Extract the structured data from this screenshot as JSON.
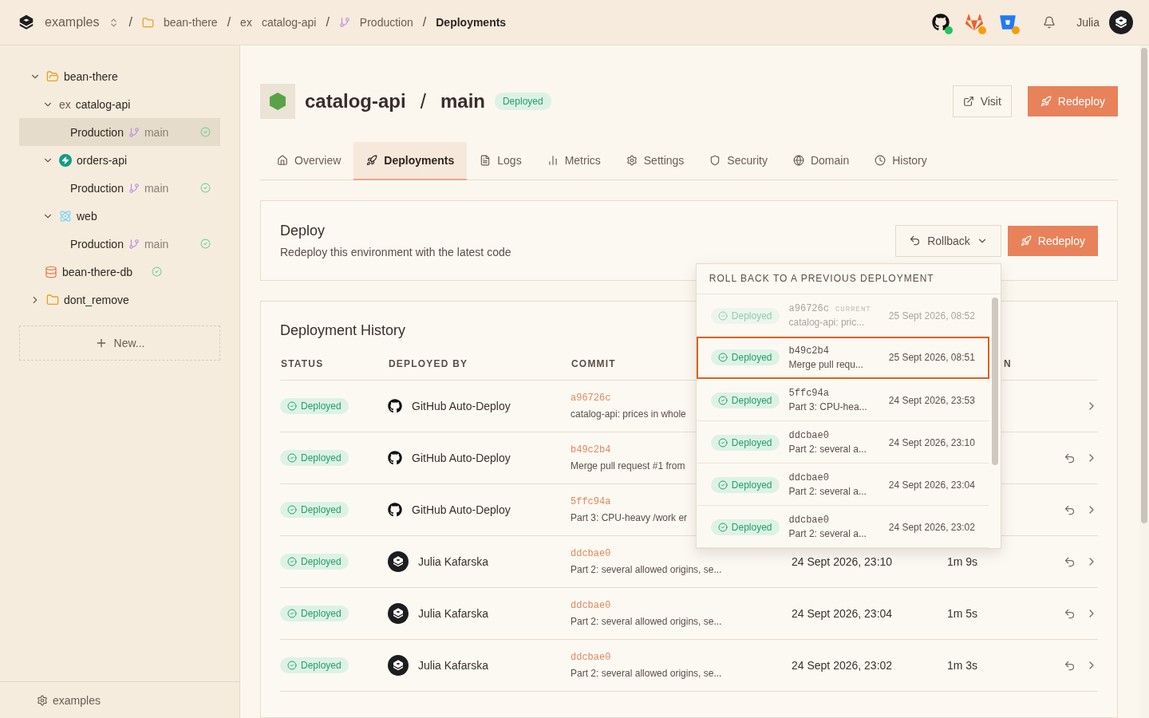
{
  "breadcrumbs": [
    {
      "kind": "switcher",
      "label": "examples"
    },
    {
      "kind": "folder",
      "separator": "/",
      "label": "bean-there"
    },
    {
      "kind": "ex",
      "separator": "/",
      "prefix": "ex",
      "label": "catalog-api"
    },
    {
      "kind": "branch",
      "separator": "/",
      "label": "Production"
    },
    {
      "kind": "current",
      "separator": "/",
      "label": "Deployments"
    }
  ],
  "integrations": [
    {
      "kind": "github",
      "color": "#22c55e"
    },
    {
      "kind": "gitlab",
      "color": "#f59e0b"
    },
    {
      "kind": "bitbucket",
      "color": "#f59e0b"
    }
  ],
  "user": {
    "name": "Julia"
  },
  "sidebar": {
    "tree": [
      {
        "label": "bean-there",
        "kind": "folder",
        "expanded": true,
        "children": [
          {
            "label": "catalog-api",
            "kind": "ex",
            "prefix": "ex",
            "expanded": true,
            "children": [
              {
                "label": "Production",
                "kind": "env",
                "branch": "main",
                "selected": true,
                "healthy": true
              }
            ]
          },
          {
            "label": "orders-api",
            "kind": "bolt",
            "expanded": true,
            "children": [
              {
                "label": "Production",
                "kind": "env",
                "branch": "main",
                "selected": false,
                "healthy": true
              }
            ]
          },
          {
            "label": "web",
            "kind": "react",
            "expanded": true,
            "children": [
              {
                "label": "Production",
                "kind": "env",
                "branch": "main",
                "selected": false,
                "healthy": true
              }
            ]
          },
          {
            "label": "bean-there-db",
            "kind": "db",
            "healthy": true,
            "selected": false
          }
        ]
      },
      {
        "label": "dont_remove",
        "kind": "folder",
        "expanded": false
      }
    ],
    "new_button": "New...",
    "footer": "examples"
  },
  "header": {
    "title": "catalog-api",
    "separator": "/",
    "branch": "main",
    "status": "Deployed",
    "visit": "Visit",
    "redeploy": "Redeploy"
  },
  "tabs": [
    {
      "label": "Overview",
      "kind": "home",
      "selected": false
    },
    {
      "label": "Deployments",
      "kind": "rocket",
      "selected": true
    },
    {
      "label": "Logs",
      "kind": "file",
      "selected": false
    },
    {
      "label": "Metrics",
      "kind": "chart",
      "selected": false
    },
    {
      "label": "Settings",
      "kind": "gear",
      "selected": false
    },
    {
      "label": "Security",
      "kind": "shield",
      "selected": false
    },
    {
      "label": "Domain",
      "kind": "globe",
      "selected": false
    },
    {
      "label": "History",
      "kind": "clock",
      "selected": false
    }
  ],
  "deploy_card": {
    "title": "Deploy",
    "subtitle": "Redeploy this environment with the latest code",
    "rollback": "Rollback",
    "redeploy": "Redeploy"
  },
  "rollback_menu": {
    "title": "ROLL BACK TO A PREVIOUS DEPLOYMENT",
    "items": [
      {
        "status": "Deployed",
        "hash": "a96726c",
        "tag": "CURRENT",
        "message": "catalog-api: pric...",
        "date": "25 Sept 2026, 08:52",
        "current": true,
        "selected": false
      },
      {
        "status": "Deployed",
        "hash": "b49c2b4",
        "message": "Merge pull requ...",
        "date": "25 Sept 2026, 08:51",
        "current": false,
        "selected": true
      },
      {
        "status": "Deployed",
        "hash": "5ffc94a",
        "message": "Part 3: CPU-hea...",
        "date": "24 Sept 2026, 23:53",
        "current": false,
        "selected": false
      },
      {
        "status": "Deployed",
        "hash": "ddcbae0",
        "message": "Part 2: several a...",
        "date": "24 Sept 2026, 23:10",
        "current": false,
        "selected": false
      },
      {
        "status": "Deployed",
        "hash": "ddcbae0",
        "message": "Part 2: several a...",
        "date": "24 Sept 2026, 23:04",
        "current": false,
        "selected": false
      },
      {
        "status": "Deployed",
        "hash": "ddcbae0",
        "message": "Part 2: several a...",
        "date": "24 Sept 2026, 23:02",
        "current": false,
        "selected": false
      }
    ]
  },
  "history": {
    "title": "Deployment History",
    "columns": [
      "STATUS",
      "DEPLOYED BY",
      "COMMIT"
    ],
    "column_5_fragment": "N",
    "rows": [
      {
        "status": "Deployed",
        "by": "GitHub Auto-Deploy",
        "kind": "github",
        "hash": "a96726c",
        "message": "catalog-api: prices in whole",
        "rollback": false
      },
      {
        "status": "Deployed",
        "by": "GitHub Auto-Deploy",
        "kind": "github",
        "hash": "b49c2b4",
        "message": "Merge pull request #1 from",
        "rollback": true
      },
      {
        "status": "Deployed",
        "by": "GitHub Auto-Deploy",
        "kind": "github",
        "hash": "5ffc94a",
        "message": "Part 3: CPU-heavy /work er",
        "rollback": true
      },
      {
        "status": "Deployed",
        "by": "Julia Kafarska",
        "kind": "user",
        "hash": "ddcbae0",
        "message": "Part 2: several allowed origins, se...",
        "date": "24 Sept 2026, 23:10",
        "duration": "1m 9s",
        "rollback": true
      },
      {
        "status": "Deployed",
        "by": "Julia Kafarska",
        "kind": "user",
        "hash": "ddcbae0",
        "message": "Part 2: several allowed origins, se...",
        "date": "24 Sept 2026, 23:04",
        "duration": "1m 5s",
        "rollback": true
      },
      {
        "status": "Deployed",
        "by": "Julia Kafarska",
        "kind": "user",
        "hash": "ddcbae0",
        "message": "Part 2: several allowed origins, se...",
        "date": "24 Sept 2026, 23:02",
        "duration": "1m 3s",
        "rollback": true
      }
    ]
  }
}
